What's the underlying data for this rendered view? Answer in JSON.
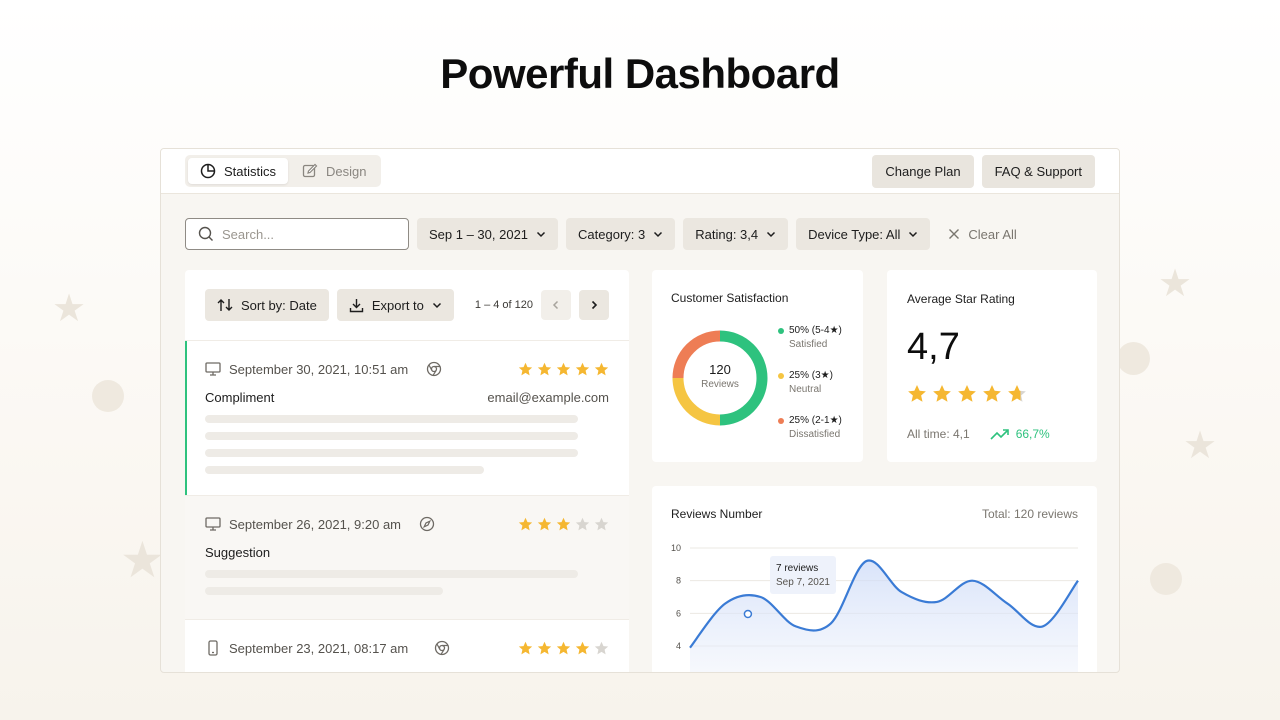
{
  "hero": {
    "title": "Powerful Dashboard"
  },
  "topbar": {
    "tabs": [
      {
        "label": "Statistics",
        "icon": "pie-chart-icon",
        "active": true
      },
      {
        "label": "Design",
        "icon": "edit-icon",
        "active": false
      }
    ],
    "actions": [
      {
        "label": "Change Plan"
      },
      {
        "label": "FAQ & Support"
      }
    ]
  },
  "filters": {
    "search_placeholder": "Search...",
    "date": "Sep 1 –  30, 2021",
    "category": "Category: 3",
    "rating": "Rating: 3,4",
    "device": "Device Type: All",
    "clear": "Clear All"
  },
  "list": {
    "sort_label": "Sort by: Date",
    "export_label": "Export to",
    "pager": "1 – 4 of 120",
    "reviews": [
      {
        "date": "September 30, 2021, 10:51 am",
        "device": "monitor-icon",
        "browser": "chrome-icon",
        "rating": 5,
        "type": "Compliment",
        "email": "email@example.com"
      },
      {
        "date": "September 26, 2021, 9:20 am",
        "device": "monitor-icon",
        "browser": "safari-icon",
        "rating": 3,
        "type": "Suggestion",
        "email": ""
      },
      {
        "date": "September 23, 2021, 08:17 am",
        "device": "mobile-icon",
        "browser": "chrome-icon",
        "rating": 4,
        "type": "",
        "email": ""
      }
    ]
  },
  "satisfaction": {
    "title": "Customer Satisfaction",
    "total": "120",
    "total_label": "Reviews",
    "segments": [
      {
        "label": "50% (5-4★)",
        "sub": "Satisfied",
        "value": 50,
        "color": "#2ec27e"
      },
      {
        "label": "25% (3★)",
        "sub": "Neutral",
        "value": 25,
        "color": "#f5c542"
      },
      {
        "label": "25% (2-1★)",
        "sub": "Dissatisfied",
        "value": 25,
        "color": "#ee7d55"
      }
    ]
  },
  "avg_rating": {
    "title": "Average Star Rating",
    "value": "4,7",
    "stars": 4.7,
    "all_time": "All time: 4,1",
    "trend": "66,7%"
  },
  "reviews_chart": {
    "title": "Reviews Number",
    "total": "Total: 120 reviews",
    "tooltip_value": "7 reviews",
    "tooltip_date": "Sep  7, 2021"
  },
  "chart_data": {
    "type": "line",
    "title": "Reviews Number",
    "xlabel": "",
    "ylabel": "",
    "y_ticks": [
      10,
      8,
      6,
      4
    ],
    "ylim": [
      3,
      10
    ],
    "x": [
      0,
      1,
      2,
      3,
      4,
      5,
      6,
      7,
      8,
      9,
      10,
      11
    ],
    "series": [
      {
        "values": [
          3.9,
          6.6,
          7.0,
          5.2,
          5.4,
          9.2,
          7.3,
          6.7,
          8.0,
          6.6,
          5.2,
          8.0
        ]
      }
    ],
    "highlight_index": 2,
    "grid": true,
    "color": "#3a7bd5"
  }
}
